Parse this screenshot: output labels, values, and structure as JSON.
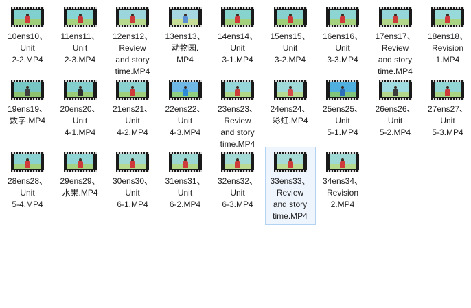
{
  "files": [
    {
      "label": "10ens10、\nUnit\n2-2.MP4",
      "colors": {
        "sky": "#7fd0cf",
        "ground": "#9fce7a",
        "body": "#d23b3b"
      }
    },
    {
      "label": "11ens11、\nUnit\n2-3.MP4",
      "colors": {
        "sky": "#86d4d6",
        "ground": "#a5d37f",
        "body": "#c93838"
      }
    },
    {
      "label": "12ens12、\nReview\nand story\ntime.MP4",
      "colors": {
        "sky": "#9ad6dc",
        "ground": "#b7d98d",
        "body": "#cc3c3c"
      }
    },
    {
      "label": "13ens13、\n动物园.\nMP4",
      "colors": {
        "sky": "#a7d7e0",
        "ground": "#c6de97",
        "body": "#5a8fd6"
      }
    },
    {
      "label": "14ens14、\nUnit\n3-1.MP4",
      "colors": {
        "sky": "#87d4cf",
        "ground": "#a3d07c",
        "body": "#d13a3a"
      }
    },
    {
      "label": "15ens15、\nUnit\n3-2.MP4",
      "colors": {
        "sky": "#86d1cf",
        "ground": "#9dce78",
        "body": "#cf3838"
      }
    },
    {
      "label": "16ens16、\nUnit\n3-3.MP4",
      "colors": {
        "sky": "#8cd5d3",
        "ground": "#a4d27e",
        "body": "#d03a3a"
      }
    },
    {
      "label": "17ens17、\nReview\nand story\ntime.MP4",
      "colors": {
        "sky": "#94d6da",
        "ground": "#b2d78a",
        "body": "#cd3b3b"
      }
    },
    {
      "label": "18ens18、\nRevision\n1.MP4",
      "colors": {
        "sky": "#98d9d9",
        "ground": "#a8d483",
        "body": "#d03c3c"
      }
    },
    {
      "label": "19ens19、\n数字.MP4",
      "colors": {
        "sky": "#76c7c3",
        "ground": "#8ec46f",
        "body": "#3e3e3e"
      }
    },
    {
      "label": "20ens20、\nUnit\n4-1.MP4",
      "colors": {
        "sky": "#82cfcd",
        "ground": "#9acb76",
        "body": "#2f2f2f"
      }
    },
    {
      "label": "21ens21、\nUnit\n4-2.MP4",
      "colors": {
        "sky": "#89d2d0",
        "ground": "#9fcf7a",
        "body": "#cf3a3a"
      }
    },
    {
      "label": "22ens22、\nUnit\n4-3.MP4",
      "colors": {
        "sky": "#6fb8e6",
        "ground": "#8fcf7f",
        "body": "#2e8bd8"
      }
    },
    {
      "label": "23ens23、\nReview\nand story\ntime.MP4",
      "colors": {
        "sky": "#95d7d8",
        "ground": "#b0d688",
        "body": "#ce3b3b"
      }
    },
    {
      "label": "24ens24、\n彩虹.MP4",
      "colors": {
        "sky": "#9fdad8",
        "ground": "#b6da8f",
        "body": "#d44b4b"
      }
    },
    {
      "label": "25ens25、\nUnit\n5-1.MP4",
      "colors": {
        "sky": "#4fb0e0",
        "ground": "#7fc47a",
        "body": "#2c6fb8"
      }
    },
    {
      "label": "26ens26、\nUnit\n5-2.MP4",
      "colors": {
        "sky": "#9fdbe0",
        "ground": "#b4d88b",
        "body": "#3a3a3a"
      }
    },
    {
      "label": "27ens27、\nUnit\n5-3.MP4",
      "colors": {
        "sky": "#91d6d4",
        "ground": "#a9d483",
        "body": "#cf3a3a"
      }
    },
    {
      "label": "28ens28、\nUnit\n5-4.MP4",
      "colors": {
        "sky": "#8ad2d1",
        "ground": "#a2d07d",
        "body": "#d03a3a"
      }
    },
    {
      "label": "29ens29、\n水果.MP4",
      "colors": {
        "sky": "#8fd5d5",
        "ground": "#a6d380",
        "body": "#cc3a3a"
      }
    },
    {
      "label": "30ens30、\nUnit\n6-1.MP4",
      "colors": {
        "sky": "#a0d9d4",
        "ground": "#b6d98d",
        "body": "#d03a3a"
      }
    },
    {
      "label": "31ens31、\nUnit\n6-2.MP4",
      "colors": {
        "sky": "#9bd8d3",
        "ground": "#b1d789",
        "body": "#cf3a3a"
      }
    },
    {
      "label": "32ens32、\nUnit\n6-3.MP4",
      "colors": {
        "sky": "#a3dad6",
        "ground": "#b9da90",
        "body": "#cf3b3b"
      }
    },
    {
      "label": "33ens33、\nReview\nand story\ntime.MP4",
      "colors": {
        "sky": "#a7dbd7",
        "ground": "#bcdb93",
        "body": "#ce3b3b"
      }
    },
    {
      "label": "34ens34、\nRevision\n2.MP4",
      "colors": {
        "sky": "#9fd9d6",
        "ground": "#b4d88c",
        "body": "#d03b3b"
      }
    }
  ],
  "selected_label": "33ens33、\nReview\nand story\ntime.MP4",
  "colors": {
    "selection_border": "#b3d3f2",
    "selection_fill": "#eef5fd",
    "label_text": "#1e1e1e"
  }
}
